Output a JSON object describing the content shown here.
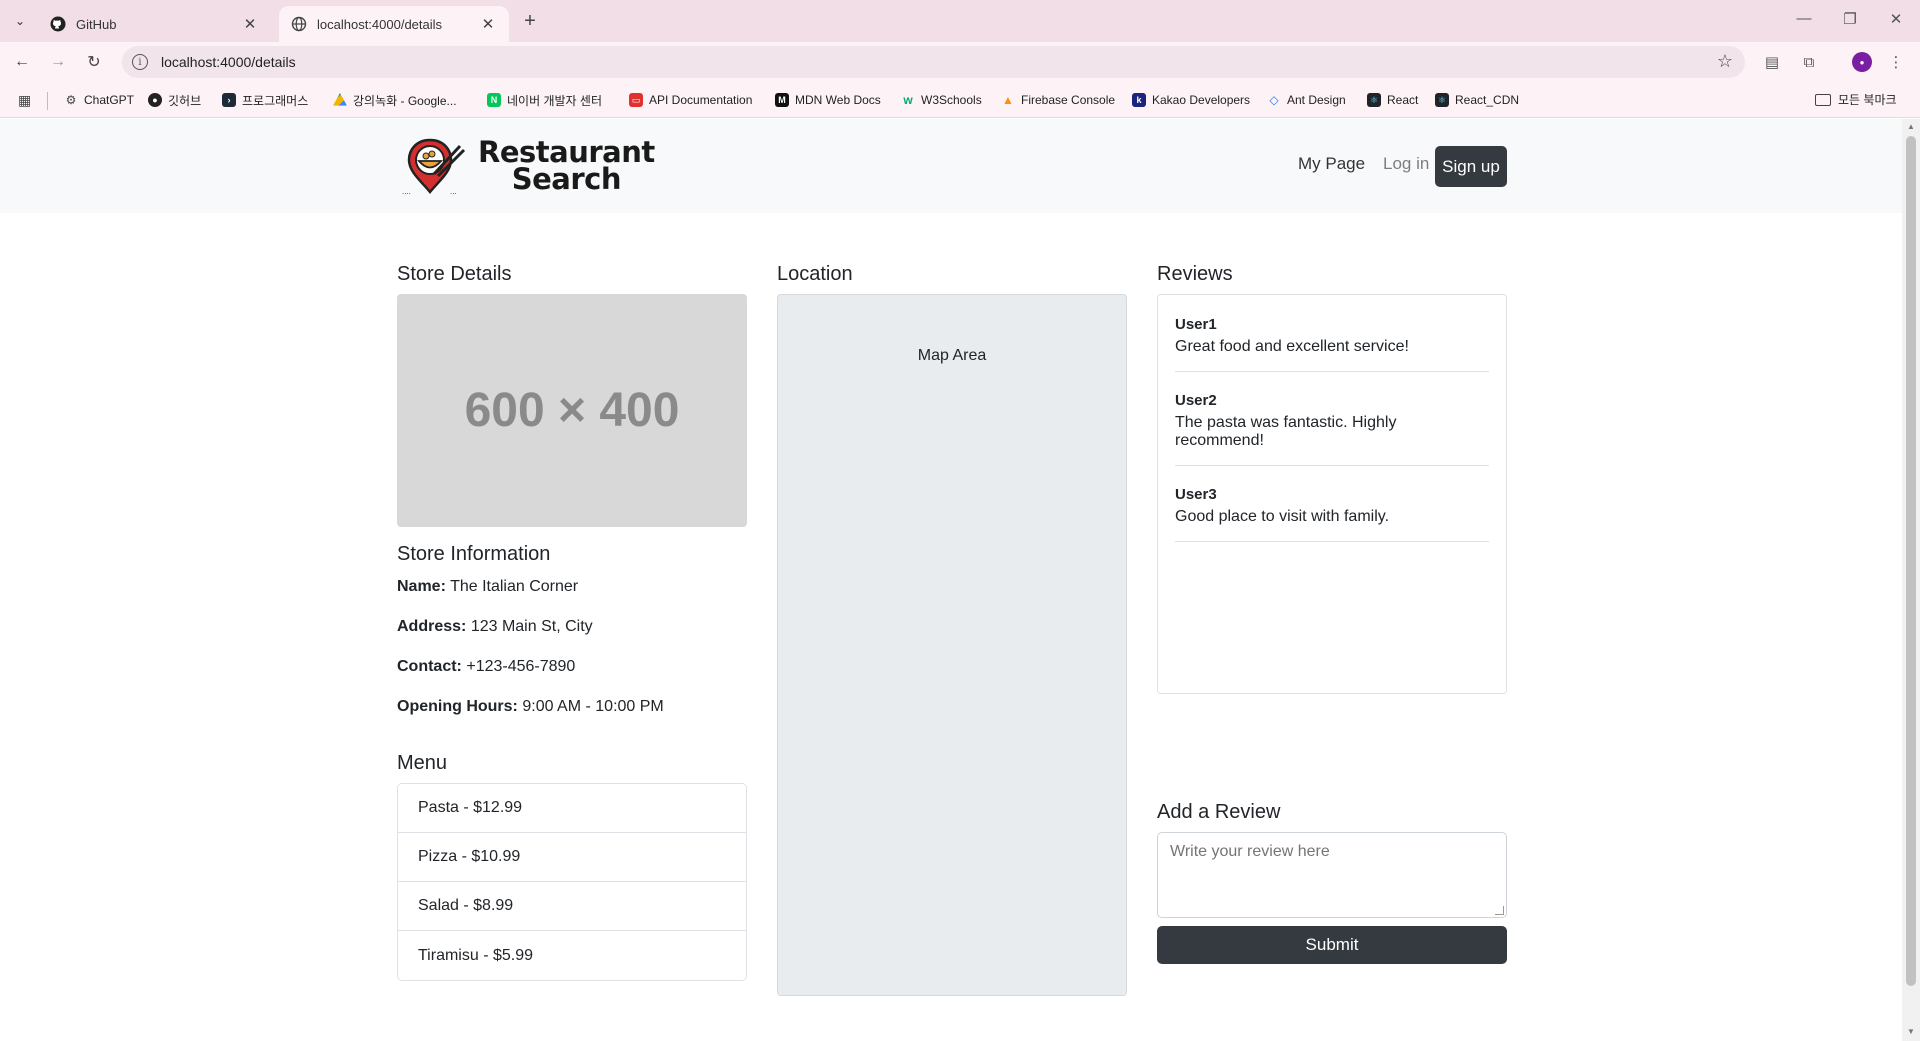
{
  "browser": {
    "tabs": [
      {
        "title": "GitHub",
        "active": false,
        "icon": "github-icon"
      },
      {
        "title": "localhost:4000/details",
        "active": true,
        "icon": "globe-icon"
      }
    ],
    "address": "localhost:4000/details",
    "bookmarks": [
      {
        "label": "ChatGPT",
        "icon": "chatgpt-icon",
        "color": "#444444"
      },
      {
        "label": "깃허브",
        "icon": "github-icon",
        "color": "#222222"
      },
      {
        "label": "프로그래머스",
        "icon": "programmers-icon",
        "color": "#1e2a3a"
      },
      {
        "label": "강의녹화 - Google...",
        "icon": "google-drive-icon",
        "color": "#f4b400"
      },
      {
        "label": "네이버 개발자 센터",
        "icon": "naver-icon",
        "color": "#03c75a"
      },
      {
        "label": "API Documentation",
        "icon": "api-doc-icon",
        "color": "#e03131"
      },
      {
        "label": "MDN Web Docs",
        "icon": "mdn-icon",
        "color": "#111111"
      },
      {
        "label": "W3Schools",
        "icon": "w3schools-icon",
        "color": "#04aa6d"
      },
      {
        "label": "Firebase Console",
        "icon": "firebase-icon",
        "color": "#ff9100"
      },
      {
        "label": "Kakao Developers",
        "icon": "kakao-icon",
        "color": "#1a237e"
      },
      {
        "label": "Ant Design",
        "icon": "ant-design-icon",
        "color": "#1677ff"
      },
      {
        "label": "React",
        "icon": "react-icon",
        "color": "#20232a"
      },
      {
        "label": "React_CDN",
        "icon": "react-cdn-icon",
        "color": "#20232a"
      }
    ],
    "all_bookmarks": "모든 북마크"
  },
  "navbar": {
    "logo_line1": "Restaurant",
    "logo_line2": "Search",
    "my_page": "My Page",
    "login": "Log in",
    "signup": "Sign up"
  },
  "store": {
    "section_title": "Store Details",
    "image_placeholder": "600 × 400",
    "info_title": "Store Information",
    "name_label": "Name:",
    "name": "The Italian Corner",
    "address_label": "Address:",
    "address": "123 Main St, City",
    "contact_label": "Contact:",
    "contact": "+123-456-7890",
    "hours_label": "Opening Hours:",
    "hours": "9:00 AM - 10:00 PM"
  },
  "menu": {
    "title": "Menu",
    "items": [
      "Pasta - $12.99",
      "Pizza - $10.99",
      "Salad - $8.99",
      "Tiramisu - $5.99"
    ]
  },
  "location": {
    "title": "Location",
    "map_label": "Map Area"
  },
  "reviews": {
    "title": "Reviews",
    "items": [
      {
        "user": "User1",
        "text": "Great food and excellent service!"
      },
      {
        "user": "User2",
        "text": "The pasta was fantastic. Highly recommend!"
      },
      {
        "user": "User3",
        "text": "Good place to visit with family."
      }
    ]
  },
  "add_review": {
    "title": "Add a Review",
    "placeholder": "Write your review here",
    "submit": "Submit"
  }
}
